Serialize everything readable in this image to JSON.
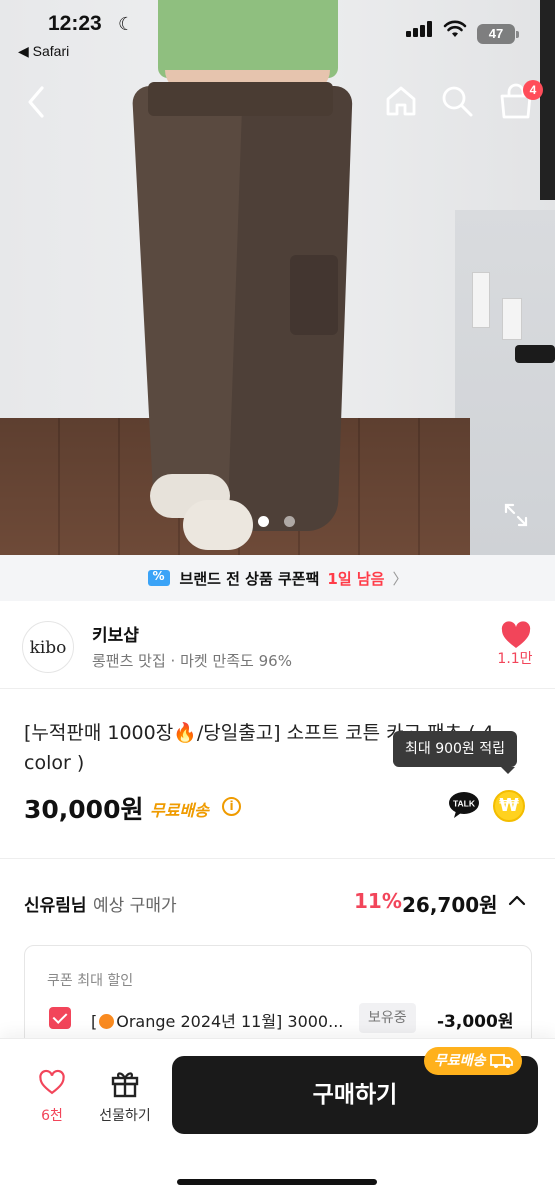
{
  "status_bar": {
    "time": "12:23",
    "back_app": "◀ Safari",
    "battery": "47"
  },
  "header": {
    "cart_count": "4",
    "icons": [
      "back-arrow-icon",
      "home-icon",
      "search-icon",
      "shopping-bag-icon"
    ]
  },
  "gallery": {
    "current_slide": 1,
    "total_slides": 2
  },
  "coupon_banner": {
    "text": "브랜드 전 상품 쿠폰팩",
    "remaining": "1일 남음",
    "accent": "#ff3b48"
  },
  "shop": {
    "logo": "kibo",
    "name": "키보샵",
    "description": "롱팬츠 맛집 · 마켓 만족도 96%",
    "like_count": "1.1만"
  },
  "product": {
    "title": "[누적판매 1000장🔥/당일출고] 소프트 코튼 카고 팬츠 ( 4 color )",
    "tooltip": "최대 900원 적립",
    "price": "30,000원",
    "shipping": "무료배송",
    "talk_label": "TALK",
    "points_symbol": "₩"
  },
  "expected_price": {
    "user_name": "신유림님",
    "label": "예상 구매가",
    "discount_pct": "11%",
    "price": "26,700원"
  },
  "coupon": {
    "header": "쿠폰 최대 할인",
    "name_prefix": "[",
    "name_rest": "Orange 2024년 11월] 3000...",
    "status": "보유중",
    "amount": "-3,000원",
    "checked": true
  },
  "bottom_bar": {
    "like_count": "6천",
    "gift_label": "선물하기",
    "buy_label": "구매하기",
    "ship_badge": "무료배송"
  },
  "colors": {
    "accent_red": "#f2455a",
    "shipping_orange": "#ef9b00",
    "buy_button": "#1a1a1a"
  }
}
